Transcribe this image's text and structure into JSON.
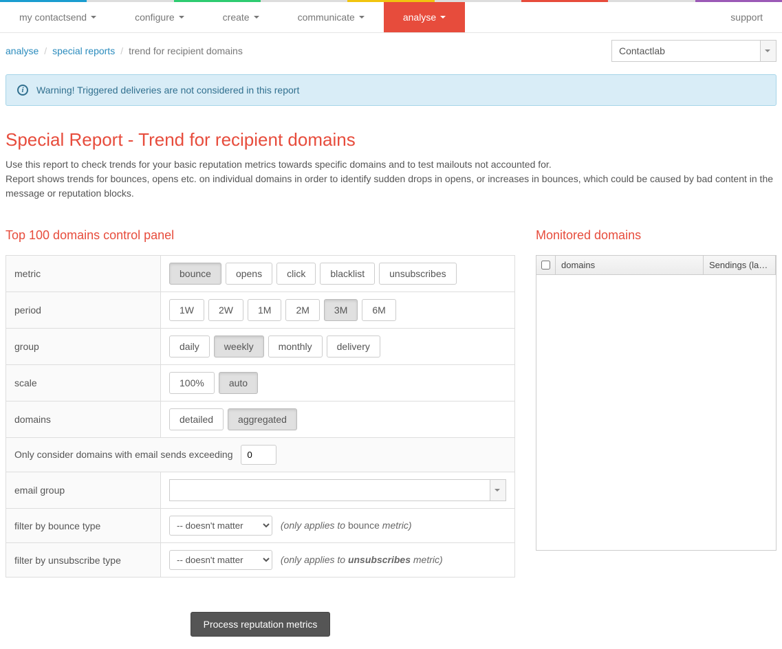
{
  "nav": {
    "items": [
      {
        "label": "my contactsend",
        "caret": true,
        "active": false
      },
      {
        "label": "configure",
        "caret": true,
        "active": false
      },
      {
        "label": "create",
        "caret": true,
        "active": false
      },
      {
        "label": "communicate",
        "caret": true,
        "active": false
      },
      {
        "label": "analyse",
        "caret": true,
        "active": true
      },
      {
        "label": "support",
        "caret": false,
        "active": false,
        "right": true
      }
    ]
  },
  "breadcrumb": {
    "items": [
      "analyse",
      "special reports",
      "trend for recipient domains"
    ]
  },
  "account_select": {
    "value": "Contactlab"
  },
  "alert": {
    "text": "Warning! Triggered deliveries are not considered in this report"
  },
  "title": "Special Report - Trend for recipient domains",
  "desc_line1": "Use this report to check trends for your basic reputation metrics towards specific domains and to test mailouts not accounted for.",
  "desc_line2": "Report shows trends for bounces, opens etc. on individual domains in order to identify sudden drops in opens, or increases in bounces, which could be caused by bad content in the message or reputation blocks.",
  "left_heading": "Top 100 domains control panel",
  "right_heading": "Monitored domains",
  "controls": {
    "metric": {
      "label": "metric",
      "options": [
        "bounce",
        "opens",
        "click",
        "blacklist",
        "unsubscribes"
      ],
      "active": "bounce"
    },
    "period": {
      "label": "period",
      "options": [
        "1W",
        "2W",
        "1M",
        "2M",
        "3M",
        "6M"
      ],
      "active": "3M"
    },
    "group": {
      "label": "group",
      "options": [
        "daily",
        "weekly",
        "monthly",
        "delivery"
      ],
      "active": "weekly"
    },
    "scale": {
      "label": "scale",
      "options": [
        "100%",
        "auto"
      ],
      "active": "auto"
    },
    "domains": {
      "label": "domains",
      "options": [
        "detailed",
        "aggregated"
      ],
      "active": "aggregated"
    },
    "threshold": {
      "label": "Only consider domains with email sends exceeding",
      "value": "0"
    },
    "email_group": {
      "label": "email group",
      "value": ""
    },
    "bounce_filter": {
      "label": "filter by bounce type",
      "value": "-- doesn't matter",
      "hint_prefix": "(only applies to",
      "hint_word": "bounce",
      "hint_suffix": "metric)"
    },
    "unsub_filter": {
      "label": "filter by unsubscribe type",
      "value": "-- doesn't matter",
      "hint_prefix": "(only applies to",
      "hint_word": "unsubscribes",
      "hint_suffix": "metric)"
    }
  },
  "monitored_table": {
    "col1": "domains",
    "col2": "Sendings (latest…"
  },
  "process_button": "Process reputation metrics"
}
